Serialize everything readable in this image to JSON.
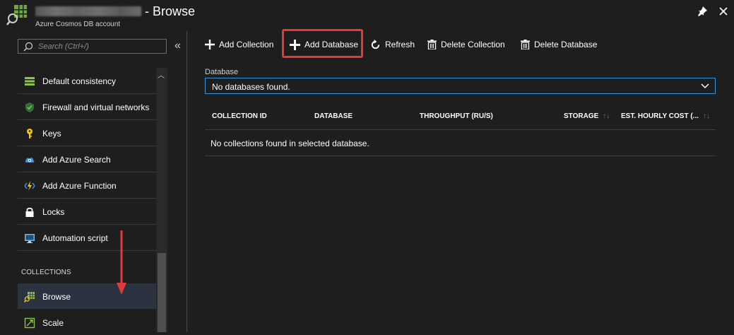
{
  "header": {
    "title": "- Browse",
    "subtitle": "Azure Cosmos DB account"
  },
  "search": {
    "placeholder": "Search (Ctrl+/)"
  },
  "sidebar": {
    "items": [
      {
        "label": "Default consistency",
        "icon": "consistency-icon"
      },
      {
        "label": "Firewall and virtual networks",
        "icon": "firewall-icon"
      },
      {
        "label": "Keys",
        "icon": "key-icon"
      },
      {
        "label": "Add Azure Search",
        "icon": "cloud-search-icon"
      },
      {
        "label": "Add Azure Function",
        "icon": "function-bolt-icon"
      },
      {
        "label": "Locks",
        "icon": "lock-icon"
      },
      {
        "label": "Automation script",
        "icon": "automation-icon"
      }
    ],
    "section": "COLLECTIONS",
    "section_items": [
      {
        "label": "Browse",
        "icon": "browse-icon",
        "selected": true
      },
      {
        "label": "Scale",
        "icon": "scale-icon"
      }
    ]
  },
  "toolbar": {
    "add_collection": "Add Collection",
    "add_database": "Add Database",
    "refresh": "Refresh",
    "delete_collection": "Delete Collection",
    "delete_database": "Delete Database"
  },
  "database": {
    "label": "Database",
    "selected": "No databases found."
  },
  "table": {
    "columns": [
      "COLLECTION ID",
      "DATABASE",
      "THROUGHPUT (RU/S)",
      "STORAGE",
      "EST. HOURLY COST (..."
    ],
    "empty_message": "No collections found in selected database."
  },
  "colors": {
    "accent": "#3b8fd4",
    "highlight": "#e03a3a",
    "background": "#1e1e1e",
    "selected_item": "#2b3340"
  }
}
